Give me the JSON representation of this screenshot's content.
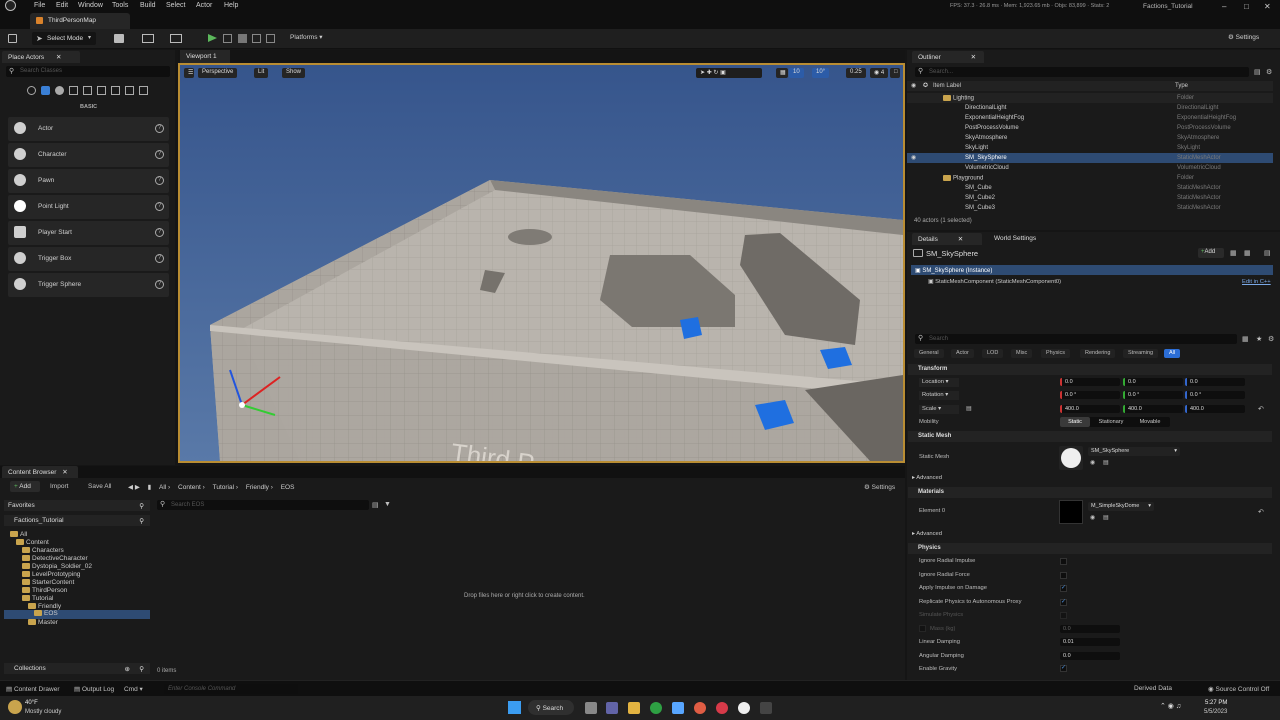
{
  "menubar": {
    "items": [
      "File",
      "Edit",
      "Window",
      "Tools",
      "Build",
      "Select",
      "Actor",
      "Help"
    ],
    "stats": "FPS: 37.3 · 26.8 ms · Mem: 1,923.65 mb · Objs: 83,899 · Stats: 2",
    "project": "Factions_Tutorial"
  },
  "map_tab": "ThirdPersonMap",
  "toolbar": {
    "select_mode": "Select Mode",
    "platforms": "Platforms",
    "settings": "Settings"
  },
  "place_actors": {
    "tab": "Place Actors",
    "search_placeholder": "Search Classes",
    "category": "BASIC",
    "items": [
      "Actor",
      "Character",
      "Pawn",
      "Point Light",
      "Player Start",
      "Trigger Box",
      "Trigger Sphere"
    ]
  },
  "viewport": {
    "tab": "Viewport 1",
    "perspective": "Perspective",
    "lit": "Lit",
    "show": "Show",
    "grid_snap": "10",
    "rot_snap": "10°",
    "scale_snap": "0.25",
    "cam_speed": "4",
    "floor_text": "Third P"
  },
  "content_browser": {
    "tab": "Content Browser",
    "add": "Add",
    "import": "Import",
    "save_all": "Save All",
    "breadcrumb": [
      "All",
      "Content",
      "Tutorial",
      "Friendly",
      "EOS"
    ],
    "settings": "Settings",
    "favorites": "Favorites",
    "project": "Factions_Tutorial",
    "search_placeholder": "Search EOS",
    "tree": [
      "All",
      "Content",
      "Characters",
      "DetectiveCharacter",
      "Dystopia_Soldier_02",
      "LevelPrototyping",
      "StarterContent",
      "ThirdPerson",
      "Tutorial",
      "Friendly",
      "EOS",
      "Master"
    ],
    "empty_msg": "Drop files here or right click to create content.",
    "collections": "Collections",
    "count": "0 items"
  },
  "outliner": {
    "tab": "Outliner",
    "search_placeholder": "Search...",
    "col_label": "Item Label",
    "col_type": "Type",
    "rows": [
      {
        "name": "Lighting",
        "type": "Folder"
      },
      {
        "name": "DirectionalLight",
        "type": "DirectionalLight"
      },
      {
        "name": "ExponentialHeightFog",
        "type": "ExponentialHeightFog"
      },
      {
        "name": "PostProcessVolume",
        "type": "PostProcessVolume"
      },
      {
        "name": "SkyAtmosphere",
        "type": "SkyAtmosphere"
      },
      {
        "name": "SkyLight",
        "type": "SkyLight"
      },
      {
        "name": "SM_SkySphere",
        "type": "StaticMeshActor"
      },
      {
        "name": "VolumetricCloud",
        "type": "VolumetricCloud"
      },
      {
        "name": "Playground",
        "type": "Folder"
      },
      {
        "name": "SM_Cube",
        "type": "StaticMeshActor"
      },
      {
        "name": "SM_Cube2",
        "type": "StaticMeshActor"
      },
      {
        "name": "SM_Cube3",
        "type": "StaticMeshActor"
      }
    ],
    "footer": "40 actors (1 selected)"
  },
  "details": {
    "tab": "Details",
    "tab2": "World Settings",
    "actor_name": "SM_SkySphere",
    "add": "Add",
    "instance": "SM_SkySphere (Instance)",
    "component": "StaticMeshComponent (StaticMeshComponent0)",
    "edit_cpp": "Edit in C++",
    "search_placeholder": "Search",
    "filters": [
      "General",
      "Actor",
      "LOD",
      "Misc",
      "Physics",
      "Rendering",
      "Streaming",
      "All"
    ],
    "transform": "Transform",
    "location": "Location",
    "rotation": "Rotation",
    "scale": "Scale",
    "loc": [
      "0.0",
      "0.0",
      "0.0"
    ],
    "rot": [
      "0.0 °",
      "0.0 °",
      "0.0 °"
    ],
    "scl": [
      "400.0",
      "400.0",
      "400.0"
    ],
    "mobility": "Mobility",
    "mob_opts": [
      "Static",
      "Stationary",
      "Movable"
    ],
    "static_mesh_sect": "Static Mesh",
    "static_mesh": "Static Mesh",
    "mesh_value": "SM_SkySphere",
    "advanced": "Advanced",
    "materials": "Materials",
    "element0": "Element 0",
    "material_value": "M_SimpleSkyDome",
    "physics": "Physics",
    "phys_props": [
      "Ignore Radial Impulse",
      "Ignore Radial Force",
      "Apply Impulse on Damage",
      "Replicate Physics to Autonomous Proxy",
      "Simulate Physics",
      "Mass (kg)",
      "Linear Damping",
      "Angular Damping",
      "Enable Gravity"
    ],
    "mass": "0.0",
    "linear_damping": "0.01",
    "angular_damping": "0.0"
  },
  "statusbar": {
    "content_drawer": "Content Drawer",
    "output_log": "Output Log",
    "cmd": "Cmd",
    "console_placeholder": "Enter Console Command",
    "derived_data": "Derived Data",
    "source_control": "Source Control Off"
  },
  "taskbar": {
    "weather_temp": "40°F",
    "weather_desc": "Mostly cloudy",
    "search": "Search",
    "time": "5:27 PM",
    "date": "5/5/2023"
  }
}
